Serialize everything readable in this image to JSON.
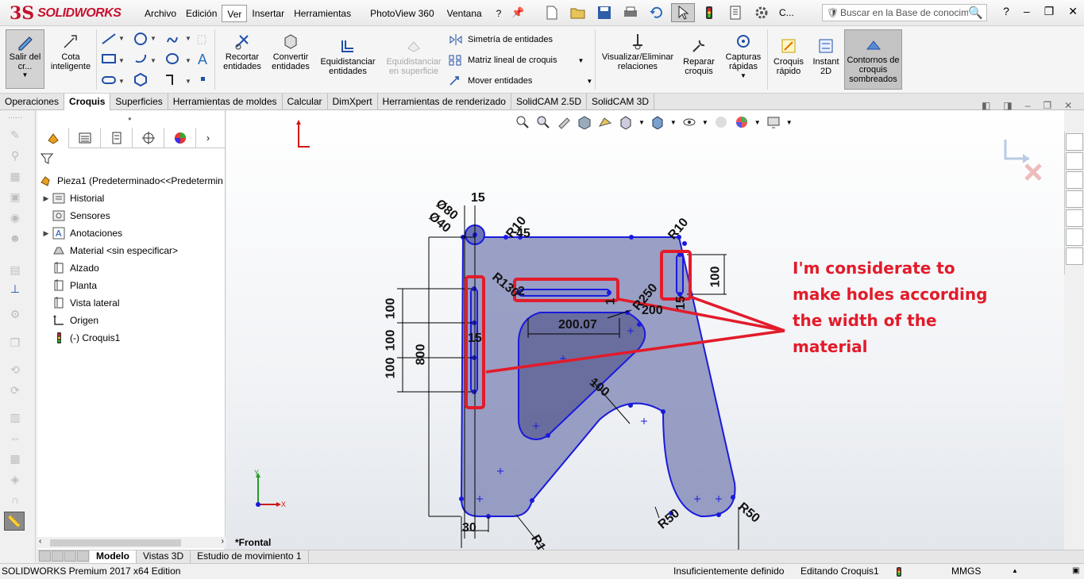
{
  "app": {
    "title": "SOLIDWORKS",
    "logo_mark": "3S"
  },
  "menubar": [
    "Archivo",
    "Edición",
    "Ver",
    "Insertar",
    "Herramientas",
    "PhotoView 360",
    "Ventana",
    "?"
  ],
  "menubar_active": "Ver",
  "search": {
    "placeholder": "Buscar en la Base de conocim"
  },
  "quick_more": "C...",
  "ribbon": {
    "exit_sketch": "Salir del cr...",
    "smart_dim": "Cota inteligente",
    "trim": "Recortar entidades",
    "convert": "Convertir entidades",
    "offset": "Equidistanciar entidades",
    "offset_surface": "Equidistanciar en superficie",
    "mirror": "Simetría de entidades",
    "linear_pattern": "Matriz lineal de croquis",
    "move": "Mover entidades",
    "relations": "Visualizar/Eliminar relaciones",
    "repair": "Reparar croquis",
    "snaps": "Capturas rápidas",
    "rapid": "Croquis rápido",
    "instant2d": "Instant 2D",
    "shaded": "Contornos de croquis sombreados"
  },
  "tabs": [
    "Operaciones",
    "Croquis",
    "Superficies",
    "Herramientas de moldes",
    "Calcular",
    "DimXpert",
    "Herramientas de renderizado",
    "SolidCAM 2.5D",
    "SolidCAM 3D"
  ],
  "tabs_active": "Croquis",
  "tree": {
    "root": "Pieza1  (Predeterminado<<Predetermin",
    "items": [
      {
        "label": "Historial",
        "expandable": true,
        "icon": "history-icon"
      },
      {
        "label": "Sensores",
        "expandable": false,
        "icon": "sensors-icon"
      },
      {
        "label": "Anotaciones",
        "expandable": true,
        "icon": "annotations-icon"
      },
      {
        "label": "Material <sin especificar>",
        "expandable": false,
        "icon": "material-icon"
      },
      {
        "label": "Alzado",
        "expandable": false,
        "icon": "plane-icon"
      },
      {
        "label": "Planta",
        "expandable": false,
        "icon": "plane-icon"
      },
      {
        "label": "Vista lateral",
        "expandable": false,
        "icon": "plane-icon"
      },
      {
        "label": "Origen",
        "expandable": false,
        "icon": "origin-icon"
      },
      {
        "label": "(-) Croquis1",
        "expandable": false,
        "icon": "sketch-icon"
      }
    ]
  },
  "bottom_tabs": [
    "Modelo",
    "Vistas 3D",
    "Estudio de movimiento 1"
  ],
  "bottom_tabs_active": "Modelo",
  "view_label": "*Frontal",
  "dimensions": {
    "d15_top": "15",
    "d80": "Ø80",
    "d40": "Ø40",
    "r10a": "R10",
    "d45": "45",
    "r10b": "R10",
    "r130": "R130",
    "d2": "2",
    "d100_right": "100",
    "d250": "R250",
    "d200": "200",
    "d20007": "200.07",
    "d15_mid": "15",
    "d100a": "100",
    "d100b": "100",
    "d100c": "100",
    "d800": "800",
    "d100_diag": "100",
    "d30": "30",
    "r1": "R1",
    "r50a": "R50",
    "r50b": "R50",
    "d1": "1",
    "d15_small": "15"
  },
  "annotation": {
    "lines": [
      "I'm considerate to",
      "make holes according",
      "the width of the",
      "material"
    ]
  },
  "status": {
    "edition": "SOLIDWORKS Premium 2017 x64 Edition",
    "defined": "Insuficientemente definido",
    "editing": "Editando Croquis1",
    "units": "MMGS"
  },
  "colors": {
    "sketch_fill": "#7b82b3",
    "sketch_line": "#1a1adc",
    "highlight_red": "#e21b2a",
    "brand_red": "#c8102e"
  }
}
